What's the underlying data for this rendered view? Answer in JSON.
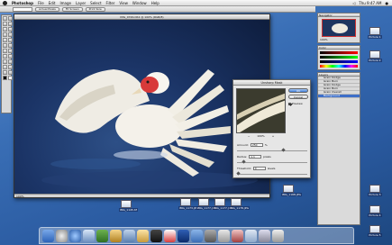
{
  "menubar": {
    "app_name": "Photoshop",
    "items": [
      "File",
      "Edit",
      "Image",
      "Layer",
      "Select",
      "Filter",
      "View",
      "Window",
      "Help"
    ],
    "clock": "Thu 9:47 AM"
  },
  "optbar": {
    "buttons": [
      "Actual Pixels",
      "Fit Screen",
      "Print Size"
    ]
  },
  "document": {
    "title": "IMG_0746.CR2 @ 100% (RGB/8)",
    "status": "100%"
  },
  "dialog": {
    "title": "Unsharp Mask",
    "ok_label": "OK",
    "cancel_label": "Cancel",
    "preview_label": "Preview",
    "preview_checked": true,
    "zoom_out": "−",
    "zoom_level": "100%",
    "zoom_in": "+",
    "amount_label": "Amount:",
    "amount_value": "250",
    "amount_unit": "%",
    "radius_label": "Radius:",
    "radius_value": "1.1",
    "radius_unit": "pixels",
    "threshold_label": "Threshold:",
    "threshold_value": "0",
    "threshold_unit": "levels"
  },
  "navigator": {
    "title": "Navigator",
    "zoom": "100%"
  },
  "color_panel": {
    "title": "Color"
  },
  "layers": {
    "title": "Layers",
    "rows": [
      "Grain Dodge",
      "Grain Burn",
      "Grain Dodge",
      "Grain Burn",
      "Grain Overall",
      "Background"
    ]
  },
  "desktop_icons": [
    "IMG_1145.tif",
    "IMG_1173.JPG",
    "IMG_1177.JPG",
    "IMG_1177.JPG",
    "IMG_1178.JPG",
    "IMG_1168.JPG",
    "Picture 1",
    "Picture 2",
    "Picture 3",
    "Picture 4",
    "Picture 5"
  ]
}
